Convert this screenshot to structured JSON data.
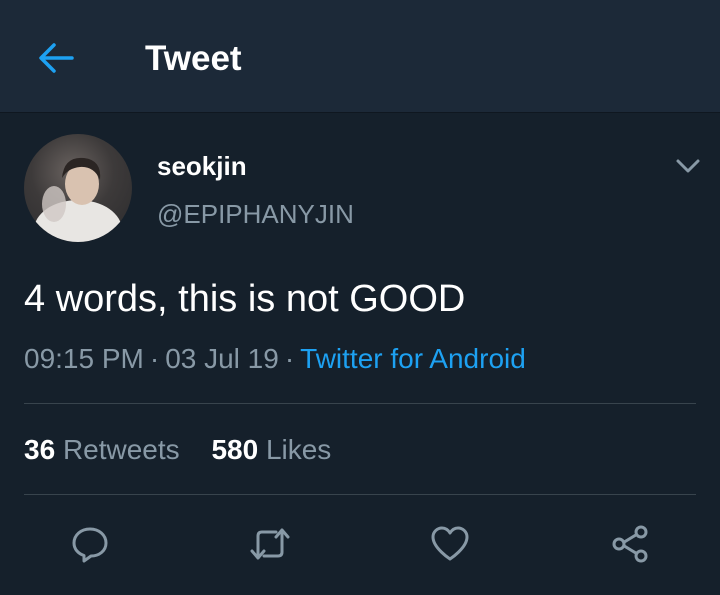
{
  "header": {
    "title": "Tweet",
    "back_icon": "arrow-left-icon"
  },
  "tweet": {
    "display_name": "seokjin",
    "handle": "@EPIPHANYJIN",
    "text": "4 words, this is not GOOD",
    "time": "09:15 PM",
    "separator": "·",
    "date": "03 Jul 19",
    "source": "Twitter for Android"
  },
  "stats": {
    "retweets_count": "36",
    "retweets_label": "Retweets",
    "likes_count": "580",
    "likes_label": "Likes"
  },
  "actions": [
    "reply-icon",
    "retweet-icon",
    "heart-icon",
    "share-icon"
  ],
  "colors": {
    "background": "#15202b",
    "header": "#1c2938",
    "accent": "#1da1f2",
    "secondary_text": "#8899a6",
    "divider": "#38444d"
  }
}
